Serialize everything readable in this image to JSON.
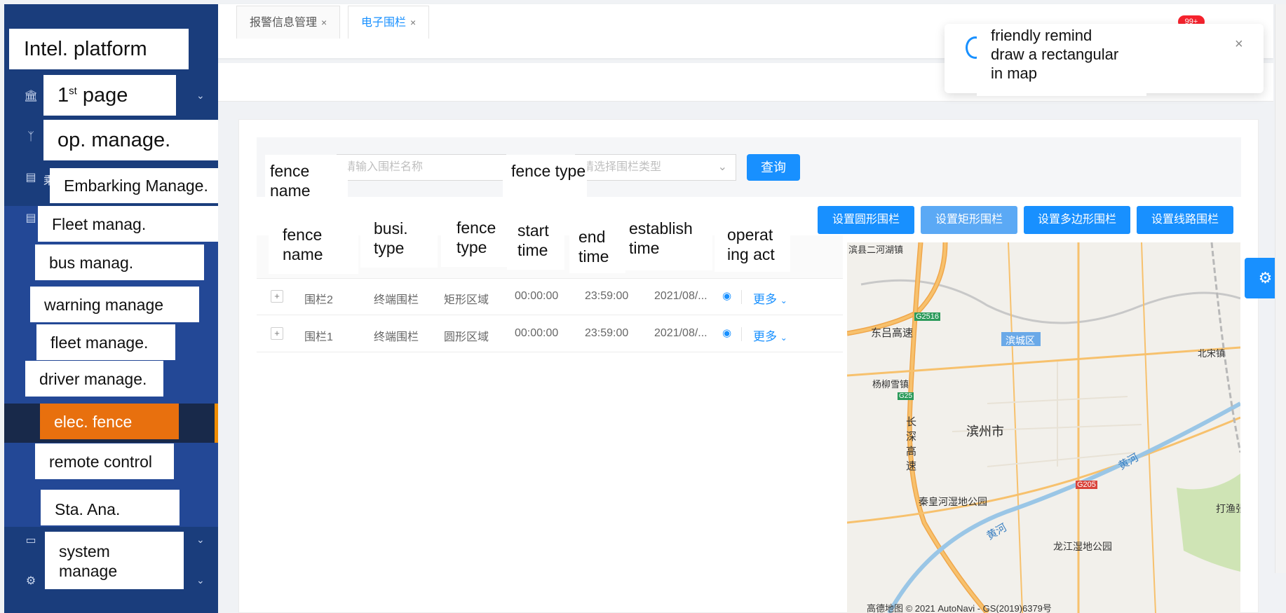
{
  "sidebar": {
    "platform_label": "Intel. platform",
    "items": [
      {
        "label": "page",
        "prefix": "1",
        "sup": "st"
      },
      {
        "label": "op. manage."
      },
      {
        "label": "Embarking Manage.",
        "hint": "乘"
      },
      {
        "label": "Fleet manag."
      },
      {
        "label": "bus manag."
      },
      {
        "label": "warning manage"
      },
      {
        "label": "fleet manage."
      },
      {
        "label": "driver manage."
      },
      {
        "label": "elec. fence"
      },
      {
        "label": "remote control"
      },
      {
        "label": "Sta. Ana."
      },
      {
        "label": "system manage"
      }
    ]
  },
  "topbar": {
    "badge": "99+"
  },
  "tabs": [
    {
      "label": "报警信息管理",
      "close": "×"
    },
    {
      "label": "电子围栏",
      "close": "×"
    }
  ],
  "search": {
    "name_label": "fence name",
    "name_placeholder": "请输入围栏名称",
    "type_label": "fence type",
    "type_placeholder": "请选择围栏类型",
    "query_button": "查询"
  },
  "fence_buttons": [
    "设置圆形围栏",
    "设置矩形围栏",
    "设置多边形围栏",
    "设置线路围栏"
  ],
  "table": {
    "headers": [
      "fence name",
      "busi. type",
      "fence type",
      "start time",
      "end time",
      "establish time",
      "operat ing act"
    ],
    "rows": [
      {
        "name": "围栏2",
        "busi_type": "终端围栏",
        "fence_type": "矩形区域",
        "start": "00:00:00",
        "end": "23:59:00",
        "created": "2021/08/...",
        "more": "更多"
      },
      {
        "name": "围栏1",
        "busi_type": "终端围栏",
        "fence_type": "圆形区域",
        "start": "00:00:00",
        "end": "23:59:00",
        "created": "2021/08/...",
        "more": "更多"
      }
    ]
  },
  "map": {
    "labels": {
      "top_left": "滨县二河湖镇",
      "dongying": "东吕高速",
      "g2516": "G2516",
      "beisong": "北宋镇",
      "bincheng": "滨城区",
      "yangliu": "杨柳雪镇",
      "g25": "G25",
      "changshen": "长深高速",
      "binzhou": "滨州市",
      "huanghe1": "黄河",
      "huanghe2": "黄河",
      "g205": "G205",
      "qinhuang": "秦皇河湿地公园",
      "dayu": "打渔张",
      "longjiang": "龙江湿地公园"
    },
    "credit": "高德地图 © 2021 AutoNavi - GS(2019)6379号"
  },
  "notification": {
    "line1": "friendly remind",
    "line2": "draw a rectangular",
    "line3": "in map",
    "close": "×"
  },
  "colors": {
    "sidebar": "#1a3d7c",
    "primary": "#1890ff",
    "active": "#e8700e"
  }
}
